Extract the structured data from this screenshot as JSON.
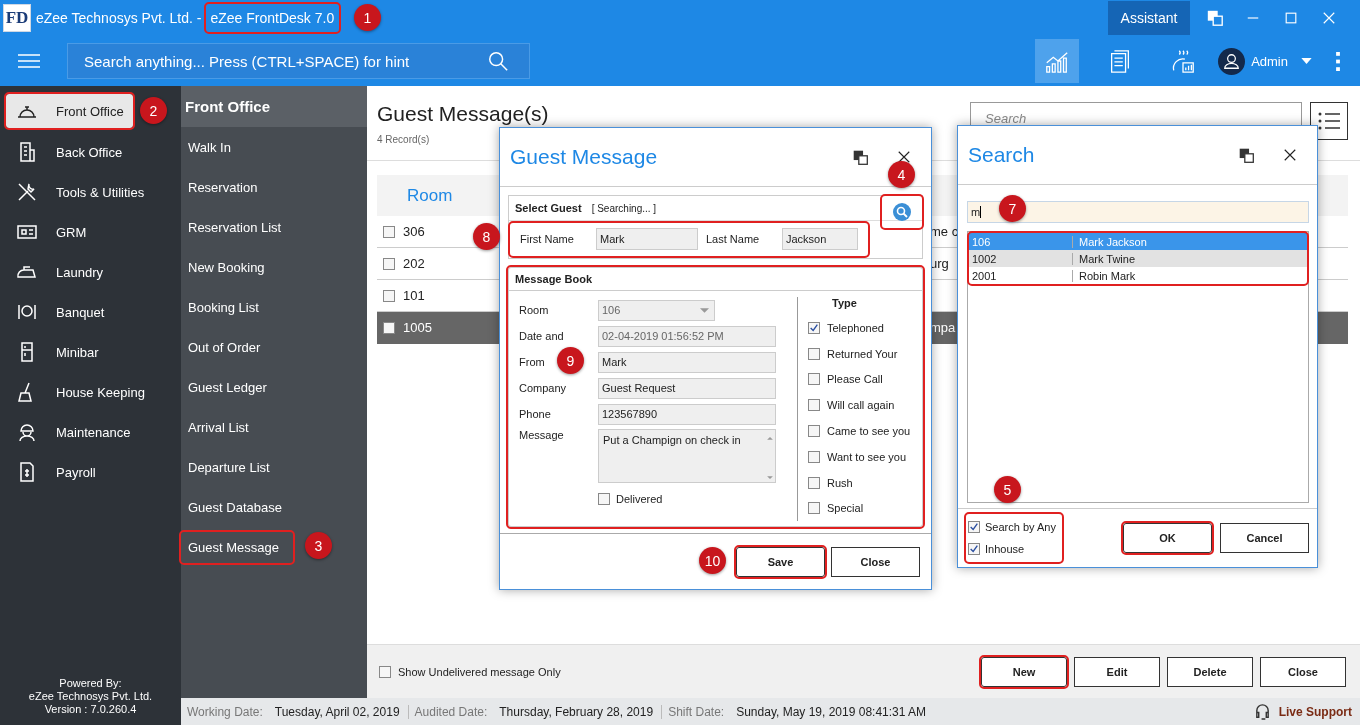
{
  "window": {
    "logo": "FD",
    "title": "eZee Technosys Pvt. Ltd. -",
    "product": "eZee FrontDesk 7.0",
    "assistant_button": "Assistant"
  },
  "toolbar": {
    "search": {
      "placeholder": "Search anything... Press (CTRL+SPACE) for hint"
    },
    "user": "Admin"
  },
  "sidebar": {
    "items": [
      {
        "label": "Front Office",
        "selected": true
      },
      {
        "label": "Back Office",
        "selected": false
      },
      {
        "label": "Tools & Utilities",
        "selected": false
      },
      {
        "label": "GRM",
        "selected": false
      },
      {
        "label": "Laundry",
        "selected": false
      },
      {
        "label": "Banquet",
        "selected": false
      },
      {
        "label": "Minibar",
        "selected": false
      },
      {
        "label": "House Keeping",
        "selected": false
      },
      {
        "label": "Maintenance",
        "selected": false
      },
      {
        "label": "Payroll",
        "selected": false
      }
    ],
    "footer": [
      "Powered By:",
      "eZee Technosys Pvt. Ltd.",
      "Version : 7.0.260.4"
    ]
  },
  "submenu": {
    "title": "Front Office",
    "items": [
      "Walk In",
      "Reservation",
      "Reservation List",
      "New Booking",
      "Booking List",
      "Out of Order",
      "Guest Ledger",
      "Arrival List",
      "Departure List",
      "Guest Database",
      "Guest Message"
    ]
  },
  "page": {
    "title": "Guest Message(s)",
    "record_count": "4 Record(s)",
    "search": {
      "placeholder": "Search"
    }
  },
  "table": {
    "columns": [
      "Room"
    ],
    "rows": [
      {
        "room": "306",
        "column_2": "me c",
        "checked": false,
        "selected": false
      },
      {
        "room": "202",
        "column_2": "urg",
        "checked": false,
        "selected": false
      },
      {
        "room": "101",
        "checked": false,
        "selected": false
      },
      {
        "room": "1005",
        "column_2": "mpa",
        "checked": false,
        "selected": true
      }
    ]
  },
  "footer": {
    "filter": {
      "label": "Show Undelivered message Only",
      "checked": false
    },
    "buttons": [
      "New",
      "Edit",
      "Delete",
      "Close"
    ]
  },
  "status_bar": [
    {
      "label": "Working Date:",
      "value": "Tuesday, April 02, 2019"
    },
    {
      "label": "Audited Date:",
      "value": "Thursday, February 28, 2019"
    },
    {
      "label": "Shift Date:",
      "value": "Sunday, May 19, 2019 08:41:31 AM"
    }
  ],
  "live_support": "Live Support",
  "guest_dialog": {
    "title": "Guest Message",
    "select_guest": {
      "label": "Select Guest",
      "status": "[ Searching... ]",
      "first_name_label": "First Name",
      "first_name": "Mark",
      "last_name_label": "Last Name",
      "last_name": "Jackson"
    },
    "message_book": {
      "title": "Message Book",
      "fields": [
        {
          "label": "Room",
          "value": "106",
          "kind": "select"
        },
        {
          "label": "Date and",
          "value": "02-04-2019  01:56:52 PM",
          "kind": "readonly"
        },
        {
          "label": "From",
          "value": "Mark",
          "kind": "text"
        },
        {
          "label": "Company",
          "value": "Guest Request",
          "kind": "text"
        },
        {
          "label": "Phone",
          "value": "123567890",
          "kind": "text"
        },
        {
          "label": "Message",
          "value": "Put a Champign on check in",
          "kind": "memo"
        }
      ],
      "delivered": {
        "label": "Delivered",
        "checked": false
      },
      "type_title": "Type",
      "types": [
        {
          "label": "Telephoned",
          "checked": true
        },
        {
          "label": "Returned Your",
          "checked": false
        },
        {
          "label": "Please Call",
          "checked": false
        },
        {
          "label": "Will call again",
          "checked": false
        },
        {
          "label": "Came to see you",
          "checked": false
        },
        {
          "label": "Want to see you",
          "checked": false
        },
        {
          "label": "Rush",
          "checked": false
        },
        {
          "label": "Special",
          "checked": false
        }
      ]
    },
    "buttons": [
      "Save",
      "Close"
    ]
  },
  "search_dialog": {
    "title": "Search",
    "query": "m",
    "results": [
      {
        "room": "106",
        "name": "Mark Jackson",
        "selected": true
      },
      {
        "room": "1002",
        "name": "Mark Twine",
        "selected": false
      },
      {
        "room": "2001",
        "name": "Robin Mark",
        "selected": false
      }
    ],
    "options": [
      {
        "label": "Search by Any",
        "checked": true
      },
      {
        "label": "Inhouse",
        "checked": true
      }
    ],
    "buttons": [
      "OK",
      "Cancel"
    ]
  },
  "annotations": [
    "1",
    "2",
    "3",
    "4",
    "5",
    "7",
    "8",
    "9",
    "10"
  ]
}
